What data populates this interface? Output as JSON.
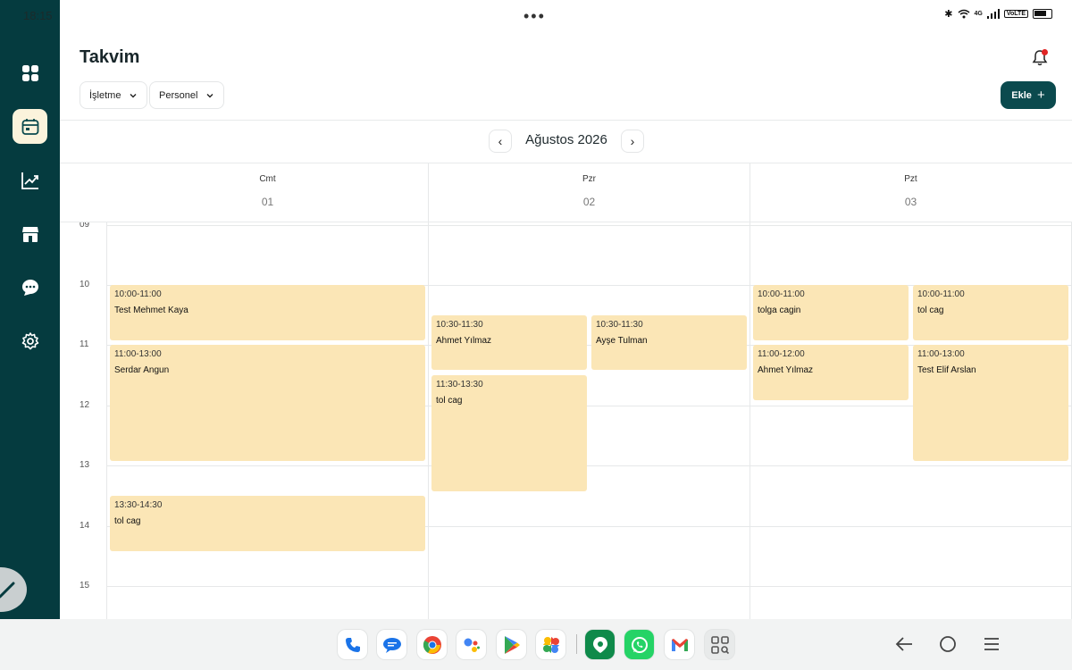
{
  "status_bar": {
    "time": "18:15",
    "dots": "•••",
    "network": "4G",
    "volte": "VoLTE"
  },
  "sidebar": {
    "items": [
      {
        "name": "dashboard",
        "icon": "grid-icon"
      },
      {
        "name": "calendar",
        "icon": "calendar-icon",
        "active": true
      },
      {
        "name": "reports",
        "icon": "chart-icon"
      },
      {
        "name": "store",
        "icon": "store-icon"
      },
      {
        "name": "messages",
        "icon": "chat-icon"
      },
      {
        "name": "settings",
        "icon": "gear-icon"
      }
    ]
  },
  "header": {
    "title": "Takvim",
    "filters": [
      {
        "label": "İşletme"
      },
      {
        "label": "Personel"
      }
    ],
    "add_label": "Ekle",
    "add_icon": "+"
  },
  "month_nav": {
    "label": "Ağustos 2026",
    "prev": "‹",
    "next": "›"
  },
  "days": [
    {
      "name": "Cmt",
      "num": "01"
    },
    {
      "name": "Pzr",
      "num": "02"
    },
    {
      "name": "Pzt",
      "num": "03"
    }
  ],
  "hours": [
    "09",
    "10",
    "11",
    "12",
    "13",
    "14",
    "15"
  ],
  "events": [
    {
      "time": "10:00-11:00",
      "name": "Test Mehmet Kaya"
    },
    {
      "time": "11:00-13:00",
      "name": "Serdar Angun"
    },
    {
      "time": "13:30-14:30",
      "name": "tol cag"
    },
    {
      "time": "10:30-11:30",
      "name": "Ahmet Yılmaz"
    },
    {
      "time": "10:30-11:30",
      "name": "Ayşe Tulman"
    },
    {
      "time": "11:30-13:30",
      "name": "tol cag"
    },
    {
      "time": "10:00-11:00",
      "name": "tolga cagin"
    },
    {
      "time": "10:00-11:00",
      "name": "tol cag"
    },
    {
      "time": "11:00-12:00",
      "name": "Ahmet Yılmaz"
    },
    {
      "time": "11:00-13:00",
      "name": "Test Elif Arslan"
    }
  ],
  "colors": {
    "sidebar": "#053b3f",
    "accent": "#0b4a4e",
    "event": "#fbe6b6",
    "active_nav": "#fbf3dc"
  },
  "dock": {
    "apps": [
      "phone-icon",
      "messages-icon",
      "chrome-icon",
      "assistant-icon",
      "play-store-icon",
      "photos-icon",
      "maps-icon",
      "whatsapp-icon",
      "gmail-icon",
      "app-drawer-icon"
    ]
  }
}
